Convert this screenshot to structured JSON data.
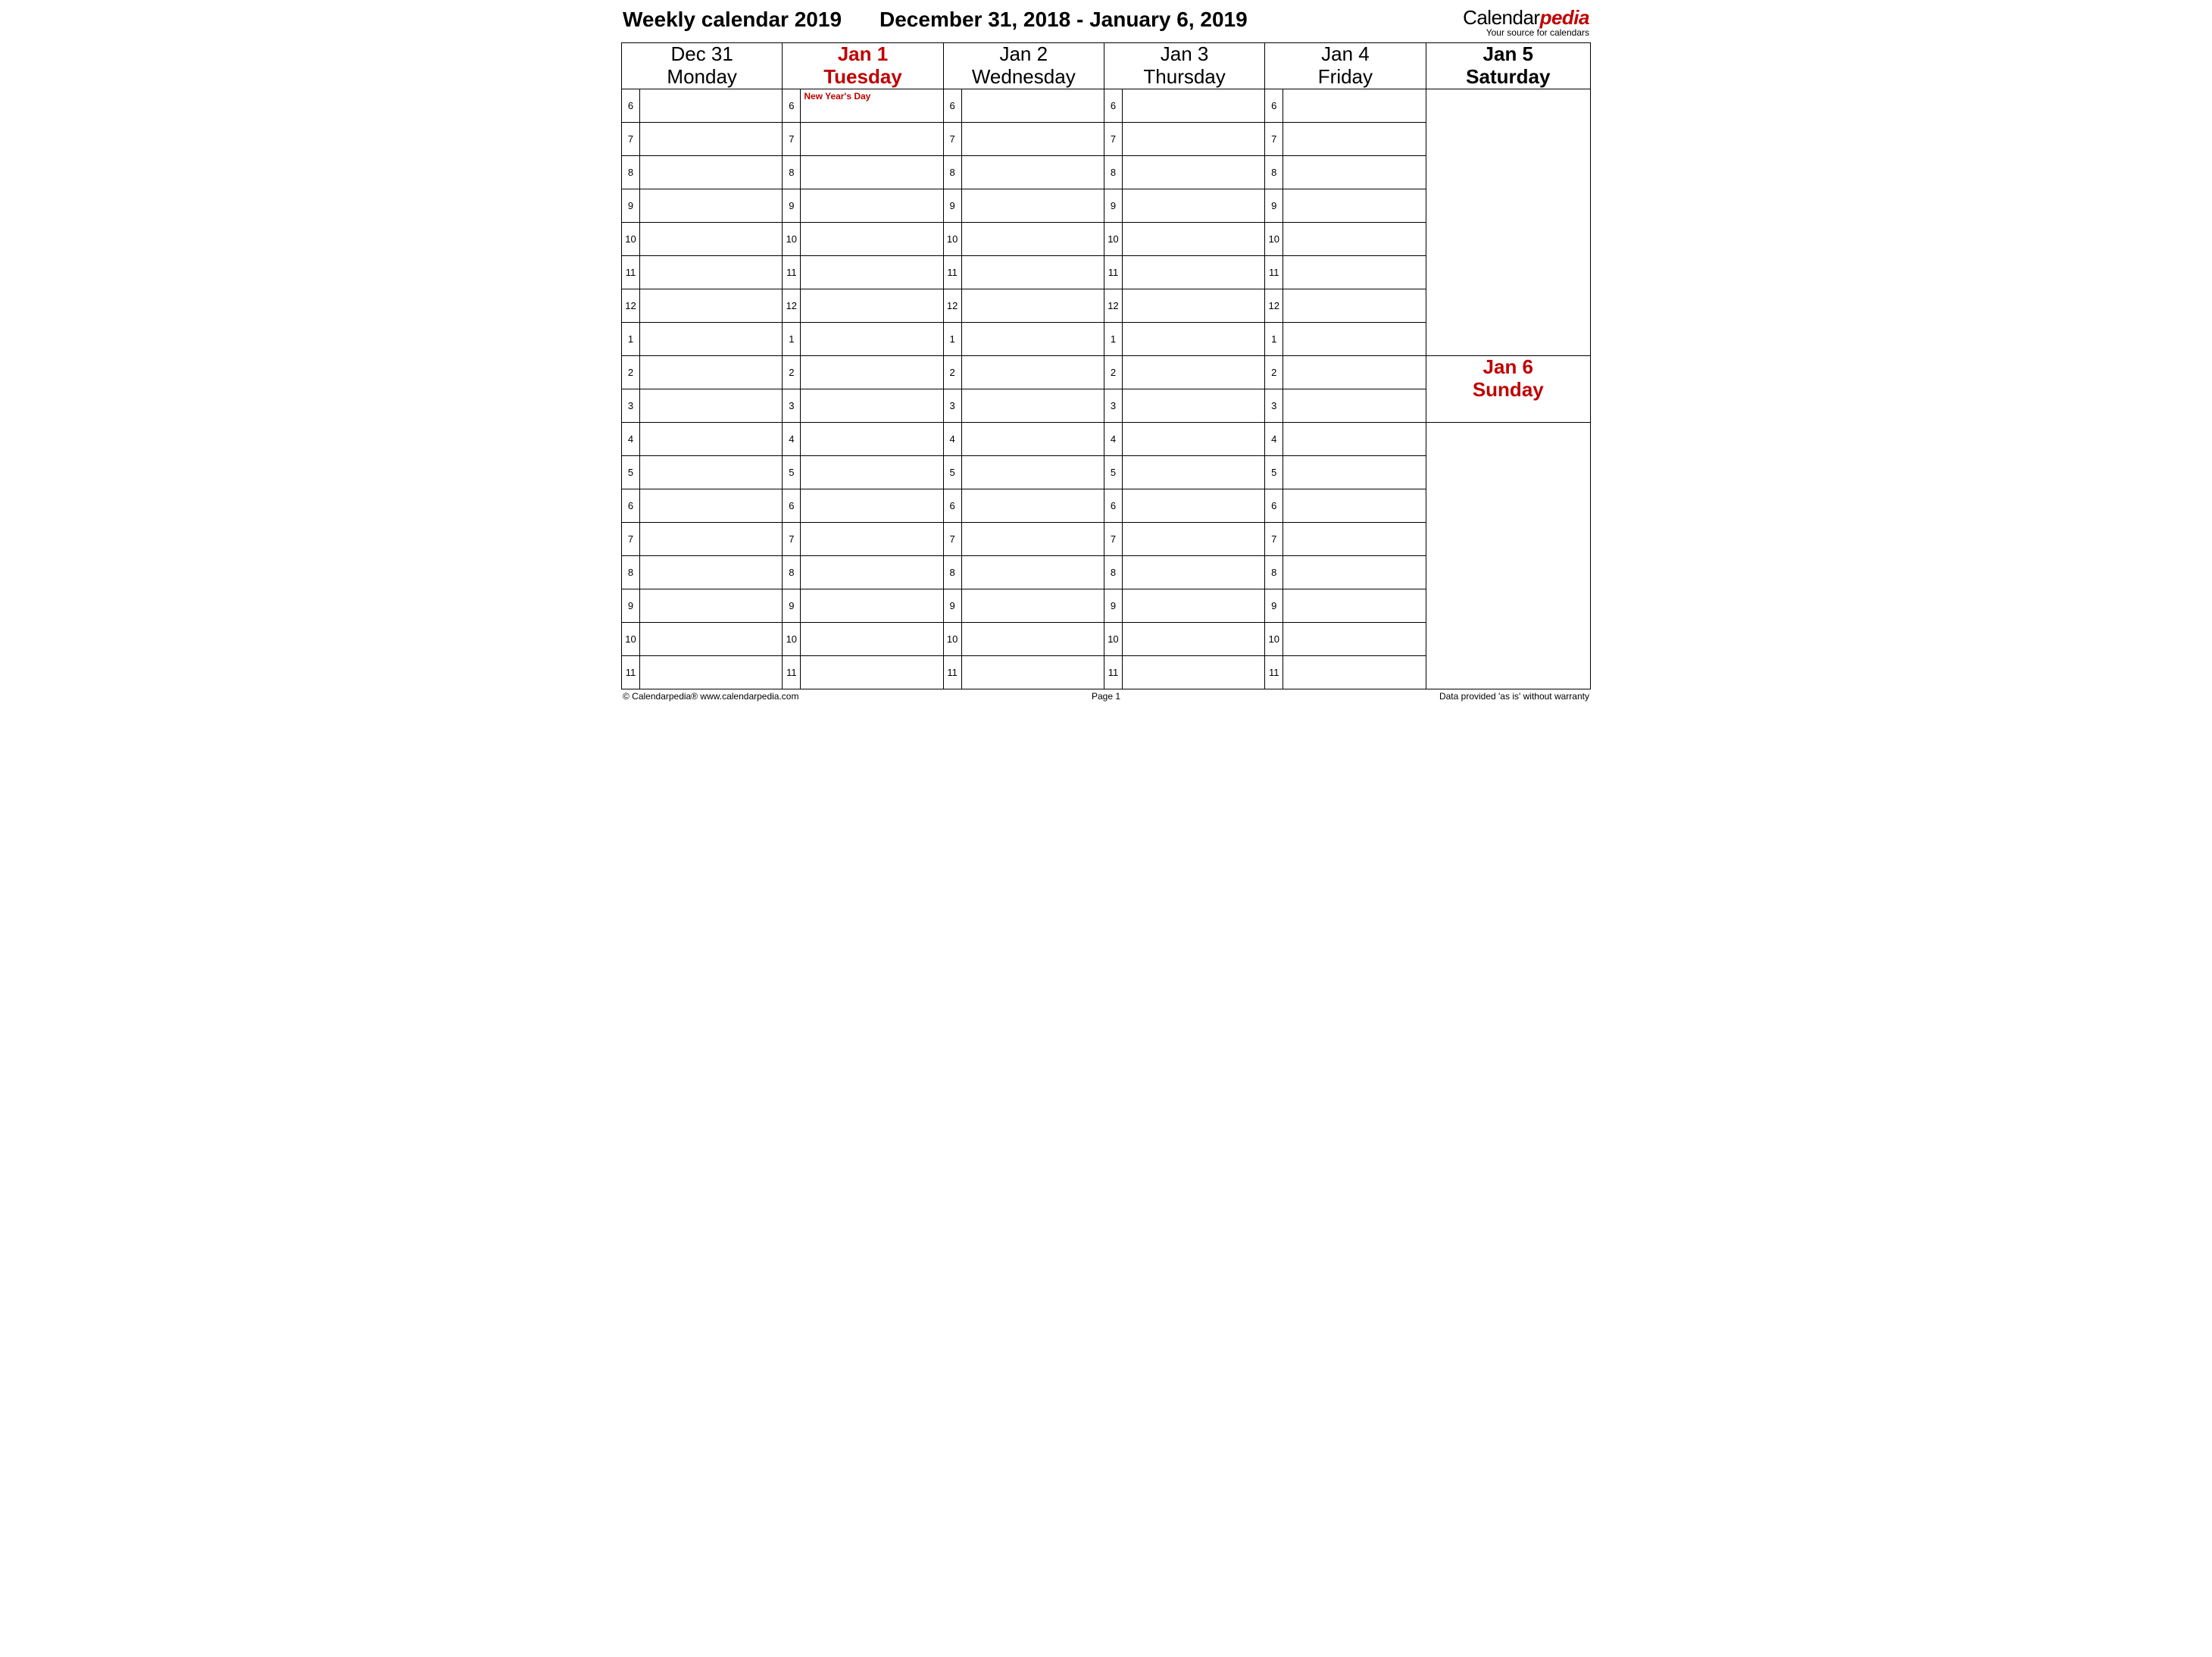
{
  "header": {
    "title_left": "Weekly calendar 2019",
    "title_center": "December 31, 2018 - January 6, 2019",
    "brand_part1": "Calendar",
    "brand_part2": "pedia",
    "brand_sub": "Your source for calendars"
  },
  "hours": [
    "6",
    "7",
    "8",
    "9",
    "10",
    "11",
    "12",
    "1",
    "2",
    "3",
    "4",
    "5",
    "6",
    "7",
    "8",
    "9",
    "10",
    "11"
  ],
  "days": [
    {
      "date": "Dec 31",
      "dow": "Monday",
      "holiday": false,
      "bold": false,
      "note": ""
    },
    {
      "date": "Jan 1",
      "dow": "Tuesday",
      "holiday": true,
      "bold": true,
      "note": "New Year's Day"
    },
    {
      "date": "Jan 2",
      "dow": "Wednesday",
      "holiday": false,
      "bold": false,
      "note": ""
    },
    {
      "date": "Jan 3",
      "dow": "Thursday",
      "holiday": false,
      "bold": false,
      "note": ""
    },
    {
      "date": "Jan 4",
      "dow": "Friday",
      "holiday": false,
      "bold": false,
      "note": ""
    }
  ],
  "weekend": {
    "sat": {
      "date": "Jan 5",
      "dow": "Saturday",
      "holiday": false
    },
    "sun": {
      "date": "Jan 6",
      "dow": "Sunday",
      "holiday": true
    }
  },
  "footer": {
    "left": "© Calendarpedia®   www.calendarpedia.com",
    "center": "Page 1",
    "right": "Data provided 'as is' without warranty"
  }
}
